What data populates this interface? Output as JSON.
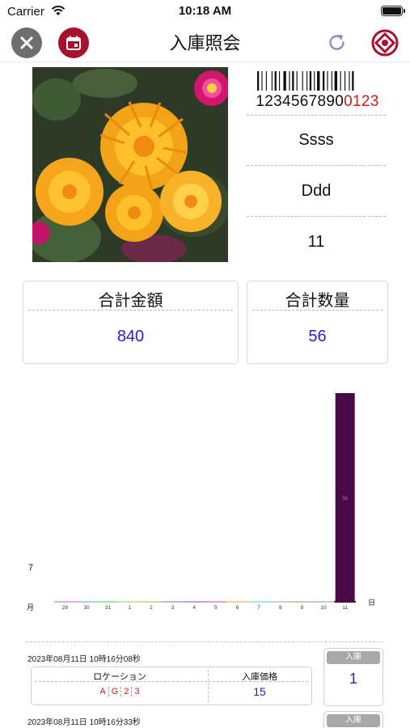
{
  "status_bar": {
    "carrier": "Carrier",
    "time": "10:18 AM"
  },
  "nav": {
    "title": "入庫照会",
    "close_icon": "close-icon",
    "calendar_icon": "calendar-icon",
    "refresh_icon": "refresh-icon",
    "logo_icon": "brand-logo-icon"
  },
  "product": {
    "image": "orange-flowers-photo",
    "barcode_number_black": "1234567890",
    "barcode_number_red": "0123",
    "name": "Ssss",
    "spec": "Ddd",
    "number": "11"
  },
  "totals": {
    "amount_label": "合計金額",
    "amount_value": "840",
    "quantity_label": "合計数量",
    "quantity_value": "56"
  },
  "chart_data": {
    "type": "bar",
    "month_label": "7",
    "x_unit_left": "月",
    "x_unit_right": "日",
    "categories": [
      "29",
      "30",
      "31",
      "1",
      "2",
      "3",
      "4",
      "5",
      "6",
      "7",
      "8",
      "9",
      "10",
      "11"
    ],
    "values": [
      0,
      0,
      0,
      0,
      0,
      0,
      0,
      0,
      0,
      0,
      0,
      0,
      0,
      56
    ],
    "data_labels": [
      "",
      "",
      "",
      "",
      "",
      "",
      "",
      "",
      "",
      "",
      "",
      "",
      "",
      "56"
    ],
    "bar_color": "#4a0a4a",
    "baseline_colors": [
      "#e9a6e6",
      "#a6d1ee",
      "#9ee9b8",
      "#c8e7a6",
      "#e6d19a",
      "#b8b8ee",
      "#c29ee0",
      "#e6a6c8",
      "#eed19a",
      "#a6e6e6",
      "#cfcfcf",
      "#d6c6a6",
      "#b6d6e6",
      "#4a0a4a"
    ]
  },
  "history": [
    {
      "timestamp": "2023年08月11日 10時16分08秒",
      "location_label": "ロケーション",
      "location_chars": [
        "A",
        "G",
        "2",
        "3"
      ],
      "price_label": "入庫価格",
      "price": "15",
      "type_label": "入庫",
      "qty": "1"
    },
    {
      "timestamp": "2023年08月11日 10時16分33秒",
      "type_label": "入庫"
    }
  ],
  "colors": {
    "accent": "#a8102e",
    "blue_value": "#2424c8",
    "red_text": "#d31a1a"
  }
}
